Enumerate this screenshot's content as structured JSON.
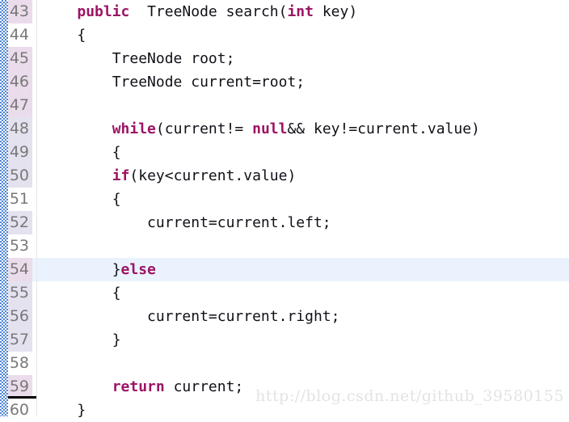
{
  "editor": {
    "first_visible_line": 43,
    "colors": {
      "keyword": "#9c1464",
      "text": "#101018",
      "gutter_pink": "#eadcea",
      "gutter_blue": "#e4e2ef",
      "current_line_highlight": "#eaf2fd",
      "change_strip": "#4f86d6",
      "line_number": "#797979",
      "watermark": "#e3e3e3"
    },
    "lines": [
      {
        "number": "43",
        "gutter_state": "pink",
        "current": false,
        "indent": "    ",
        "tokens": [
          {
            "text": "public",
            "kind": "keyword"
          },
          {
            "text": "  TreeNode search(",
            "kind": "plain"
          },
          {
            "text": "int",
            "kind": "keyword"
          },
          {
            "text": " key)",
            "kind": "plain"
          }
        ]
      },
      {
        "number": "44",
        "gutter_state": "plain",
        "current": false,
        "indent": "    ",
        "tokens": [
          {
            "text": "{",
            "kind": "plain"
          }
        ]
      },
      {
        "number": "45",
        "gutter_state": "pink",
        "current": false,
        "indent": "        ",
        "tokens": [
          {
            "text": "TreeNode root;",
            "kind": "plain"
          }
        ]
      },
      {
        "number": "46",
        "gutter_state": "pink",
        "current": false,
        "indent": "        ",
        "tokens": [
          {
            "text": "TreeNode current=root;",
            "kind": "plain"
          }
        ]
      },
      {
        "number": "47",
        "gutter_state": "pink",
        "current": false,
        "indent": "",
        "tokens": []
      },
      {
        "number": "48",
        "gutter_state": "blue",
        "current": false,
        "indent": "        ",
        "tokens": [
          {
            "text": "while",
            "kind": "keyword"
          },
          {
            "text": "(current!= ",
            "kind": "plain"
          },
          {
            "text": "null",
            "kind": "keyword"
          },
          {
            "text": "&& key!=current.value)",
            "kind": "plain"
          }
        ]
      },
      {
        "number": "49",
        "gutter_state": "blue",
        "current": false,
        "indent": "        ",
        "tokens": [
          {
            "text": "{",
            "kind": "plain"
          }
        ]
      },
      {
        "number": "50",
        "gutter_state": "blue",
        "current": false,
        "indent": "        ",
        "tokens": [
          {
            "text": "if",
            "kind": "keyword"
          },
          {
            "text": "(key<current.value)",
            "kind": "plain"
          }
        ]
      },
      {
        "number": "51",
        "gutter_state": "plain",
        "current": false,
        "indent": "        ",
        "tokens": [
          {
            "text": "{",
            "kind": "plain"
          }
        ]
      },
      {
        "number": "52",
        "gutter_state": "blue",
        "current": false,
        "indent": "            ",
        "tokens": [
          {
            "text": "current=current.left;",
            "kind": "plain"
          }
        ]
      },
      {
        "number": "53",
        "gutter_state": "plain",
        "current": false,
        "indent": "",
        "tokens": []
      },
      {
        "number": "54",
        "gutter_state": "pink",
        "current": true,
        "indent": "        ",
        "tokens": [
          {
            "text": "}",
            "kind": "plain"
          },
          {
            "text": "else",
            "kind": "keyword"
          }
        ]
      },
      {
        "number": "55",
        "gutter_state": "blue",
        "current": false,
        "indent": "        ",
        "tokens": [
          {
            "text": "{",
            "kind": "plain"
          }
        ]
      },
      {
        "number": "56",
        "gutter_state": "blue",
        "current": false,
        "indent": "            ",
        "tokens": [
          {
            "text": "current=current.right;",
            "kind": "plain"
          }
        ]
      },
      {
        "number": "57",
        "gutter_state": "blue",
        "current": false,
        "indent": "        ",
        "tokens": [
          {
            "text": "}",
            "kind": "plain"
          }
        ]
      },
      {
        "number": "58",
        "gutter_state": "plain",
        "current": false,
        "indent": "",
        "tokens": []
      },
      {
        "number": "59",
        "gutter_state": "pink",
        "current": false,
        "indent": "        ",
        "tokens": [
          {
            "text": "return",
            "kind": "keyword"
          },
          {
            "text": " current;",
            "kind": "plain"
          }
        ]
      },
      {
        "number": "60",
        "gutter_state": "plain",
        "current": false,
        "indent": "    ",
        "tokens": [
          {
            "text": "}",
            "kind": "plain"
          }
        ]
      }
    ]
  },
  "watermark": {
    "text": "http://blog.csdn.net/github_39580155"
  }
}
